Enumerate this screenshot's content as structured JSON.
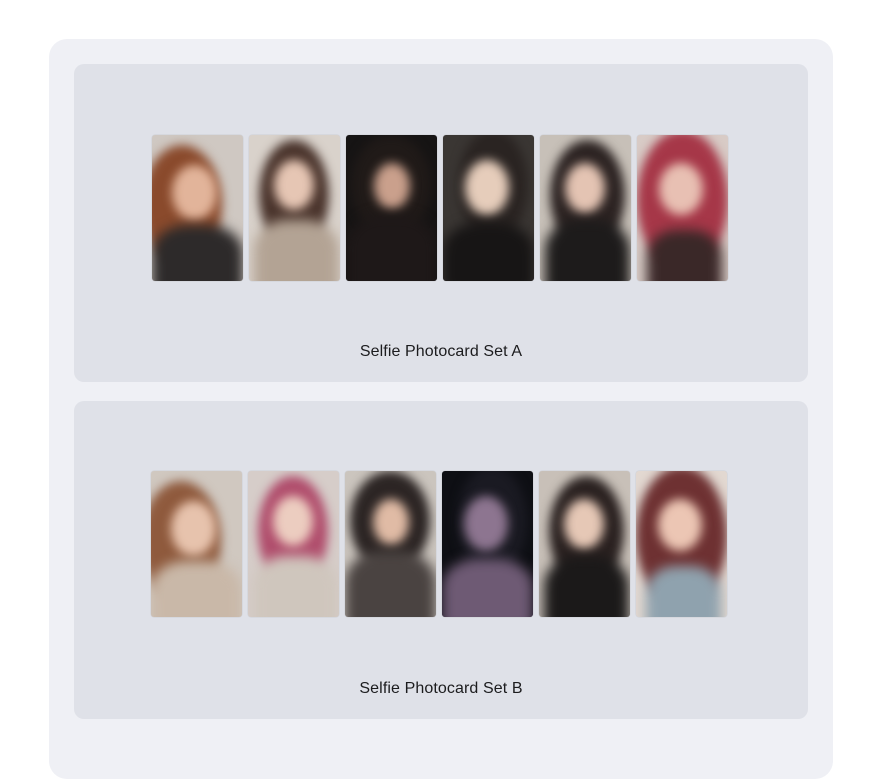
{
  "sets": [
    {
      "caption": "Selfie Photocard Set A",
      "cards": [
        {
          "bg": "#cfc8c2",
          "hair": "#8a4a2c",
          "face": "#e2b49a",
          "body": "#2d2a2a"
        },
        {
          "bg": "#d9d2cb",
          "hair": "#4a342c",
          "face": "#e6c6b4",
          "body": "#b3a394"
        },
        {
          "bg": "#161414",
          "hair": "#201a18",
          "face": "#caa08c",
          "body": "#1e1818"
        },
        {
          "bg": "#3a3633",
          "hair": "#2a2422",
          "face": "#e6cdbb",
          "body": "#171515"
        },
        {
          "bg": "#c7c0b8",
          "hair": "#2c2322",
          "face": "#e4c4b3",
          "body": "#1d1b1b"
        },
        {
          "bg": "#d8cbc6",
          "hair": "#a63748",
          "face": "#e8c0b3",
          "body": "#3a2828"
        }
      ]
    },
    {
      "caption": "Selfie Photocard Set B",
      "cards": [
        {
          "bg": "#d0c8c0",
          "hair": "#8f5a3d",
          "face": "#e7c3ad",
          "body": "#c9b8a8"
        },
        {
          "bg": "#d6cdc9",
          "hair": "#b04d6c",
          "face": "#eccdc0",
          "body": "#cfc6bd"
        },
        {
          "bg": "#cbc5be",
          "hair": "#2c2524",
          "face": "#e0bba5",
          "body": "#4a4341"
        },
        {
          "bg": "#0e0f14",
          "hair": "#1a1a22",
          "face": "#8d7590",
          "body": "#6e5a74"
        },
        {
          "bg": "#c8c0b8",
          "hair": "#2a2120",
          "face": "#e6c8b6",
          "body": "#1b1919"
        },
        {
          "bg": "#e2d8d1",
          "hair": "#6e3132",
          "face": "#ecc6b4",
          "body": "#8fa2ae"
        }
      ]
    }
  ]
}
